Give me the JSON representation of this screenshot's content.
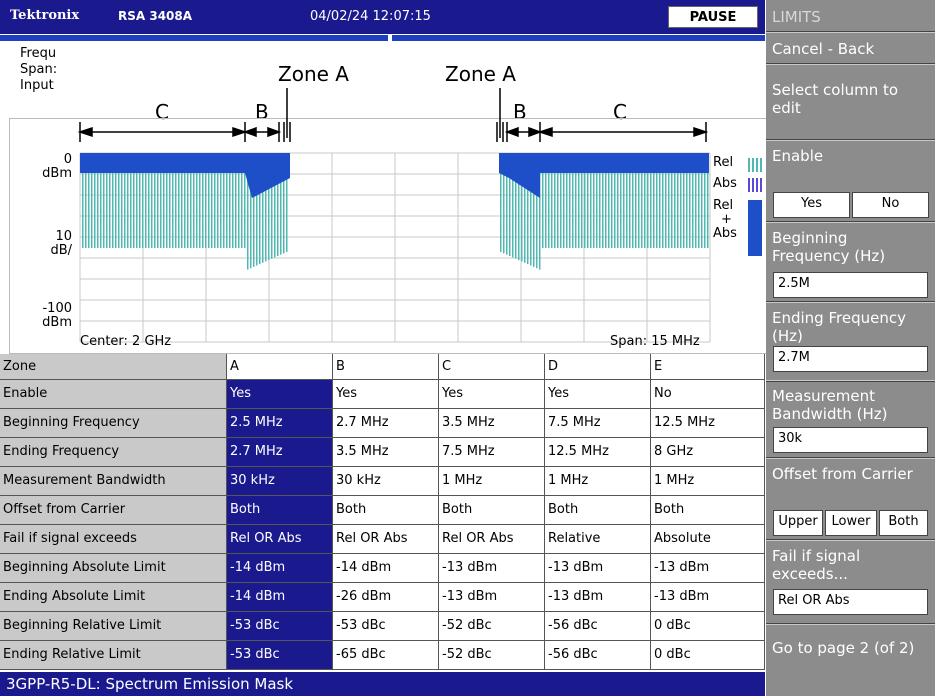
{
  "header": {
    "brand": "Tektronix",
    "model": "RSA 3408A",
    "datetime": "04/02/24 12:07:15",
    "status": "PAUSE"
  },
  "left_labels": {
    "frequency": "Frequ",
    "span": "Span:",
    "input": "Input"
  },
  "graph": {
    "y_top_value": "0",
    "y_top_unit": "dBm",
    "y_scale_value": "10",
    "y_scale_unit": "dB/",
    "y_bottom_value": "-100",
    "y_bottom_unit": "dBm",
    "center": "Center: 2 GHz",
    "span": "Span: 15 MHz",
    "legend": {
      "rel": "Rel",
      "abs": "Abs",
      "rel_abs_1": "Rel",
      "rel_abs_2": "+",
      "rel_abs_3": "Abs"
    },
    "annotations": {
      "zone_a_left": "Zone A",
      "zone_a_right": "Zone A",
      "c_left": "C",
      "b_left": "B",
      "b_right": "B",
      "c_right": "C"
    },
    "colors": {
      "mask_fill": "#1f4fc8",
      "trace": "#4fb8b0"
    }
  },
  "table": {
    "columns": [
      "Zone",
      "A",
      "B",
      "C",
      "D",
      "E"
    ],
    "rows": [
      [
        "Enable",
        "Yes",
        "Yes",
        "Yes",
        "Yes",
        "No"
      ],
      [
        "Beginning Frequency",
        "2.5 MHz",
        "2.7 MHz",
        "3.5 MHz",
        "7.5 MHz",
        "12.5 MHz"
      ],
      [
        "Ending Frequency",
        "2.7 MHz",
        "3.5 MHz",
        "7.5 MHz",
        "12.5 MHz",
        "8 GHz"
      ],
      [
        "Measurement Bandwidth",
        "30 kHz",
        "30 kHz",
        "1 MHz",
        "1 MHz",
        "1 MHz"
      ],
      [
        "Offset from Carrier",
        "Both",
        "Both",
        "Both",
        "Both",
        "Both"
      ],
      [
        "Fail if signal exceeds",
        "Rel OR Abs",
        "Rel OR Abs",
        "Rel OR Abs",
        "Relative",
        "Absolute"
      ],
      [
        "Beginning Absolute Limit",
        "-14 dBm",
        "-14 dBm",
        "-13 dBm",
        "-13 dBm",
        "-13 dBm"
      ],
      [
        "Ending Absolute Limit",
        "-14 dBm",
        "-26 dBm",
        "-13 dBm",
        "-13 dBm",
        "-13 dBm"
      ],
      [
        "Beginning Relative Limit",
        "-53 dBc",
        "-53 dBc",
        "-52 dBc",
        "-56 dBc",
        "0 dBc"
      ],
      [
        "Ending Relative Limit",
        "-53 dBc",
        "-65 dBc",
        "-52 dBc",
        "-56 dBc",
        "0 dBc"
      ]
    ]
  },
  "footer": "3GPP-R5-DL: Spectrum Emission Mask",
  "menu": {
    "title": "LIMITS",
    "cancel": "Cancel - Back",
    "select_column": "Select column to edit",
    "enable": {
      "label": "Enable",
      "yes": "Yes",
      "no": "No"
    },
    "beginning_frequency": {
      "label": "Beginning Frequency (Hz)",
      "value": "2.5M"
    },
    "ending_frequency": {
      "label": "Ending Frequency (Hz)",
      "value": "2.7M"
    },
    "measurement_bandwidth": {
      "label": "Measurement Bandwidth (Hz)",
      "value": "30k"
    },
    "offset_from_carrier": {
      "label": "Offset from Carrier",
      "upper": "Upper",
      "lower": "Lower",
      "both": "Both"
    },
    "fail_if": {
      "label": "Fail if signal exceeds...",
      "value": "Rel OR Abs"
    },
    "go_to_page": "Go to page 2 (of 2)"
  }
}
